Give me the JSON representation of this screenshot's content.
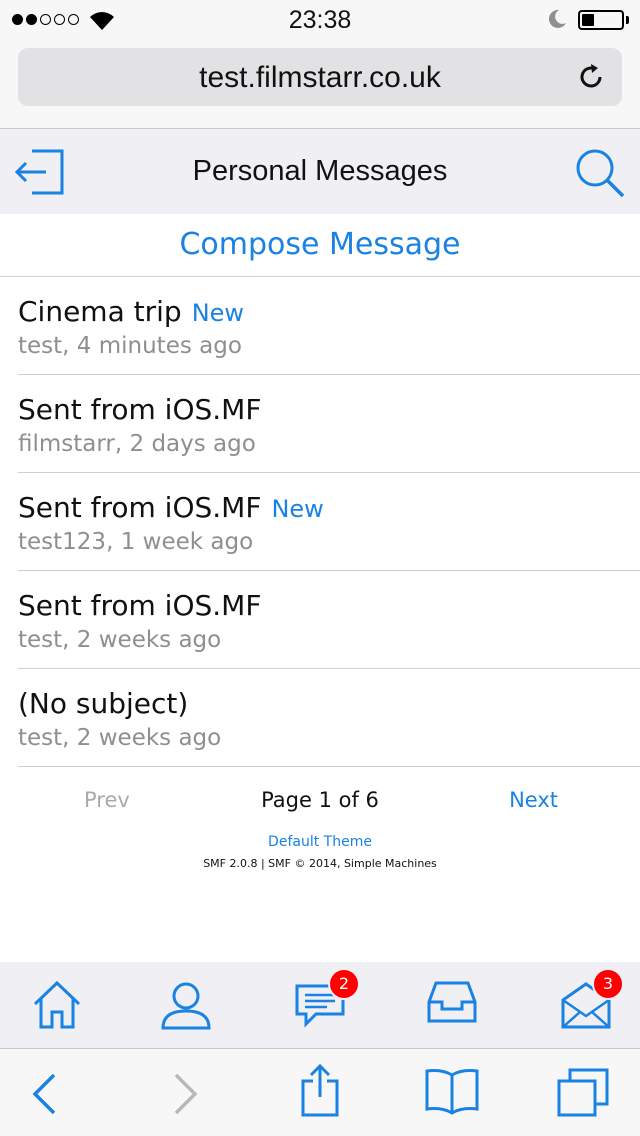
{
  "status_bar": {
    "time": "23:38"
  },
  "browser": {
    "url": "test.filmstarr.co.uk"
  },
  "header": {
    "title": "Personal Messages"
  },
  "compose_label": "Compose Message",
  "messages": [
    {
      "subject": "Cinema trip",
      "new_label": "New",
      "meta": "test, 4 minutes ago"
    },
    {
      "subject": "Sent from iOS.MF",
      "new_label": "",
      "meta": "filmstarr, 2 days ago"
    },
    {
      "subject": "Sent from iOS.MF",
      "new_label": "New",
      "meta": "test123, 1 week ago"
    },
    {
      "subject": "Sent from iOS.MF",
      "new_label": "",
      "meta": "test, 2 weeks ago"
    },
    {
      "subject": "(No subject)",
      "new_label": "",
      "meta": "test, 2 weeks ago"
    }
  ],
  "pager": {
    "prev": "Prev",
    "info": "Page 1 of 6",
    "next": "Next"
  },
  "footer": {
    "theme": "Default Theme",
    "copyright": "SMF 2.0.8 | SMF © 2014, Simple Machines"
  },
  "tab_bar": {
    "messages_badge": "2",
    "mail_badge": "3"
  },
  "colors": {
    "accent": "#1a82e2",
    "badge": "#ff0000",
    "muted": "#8e8e93"
  }
}
